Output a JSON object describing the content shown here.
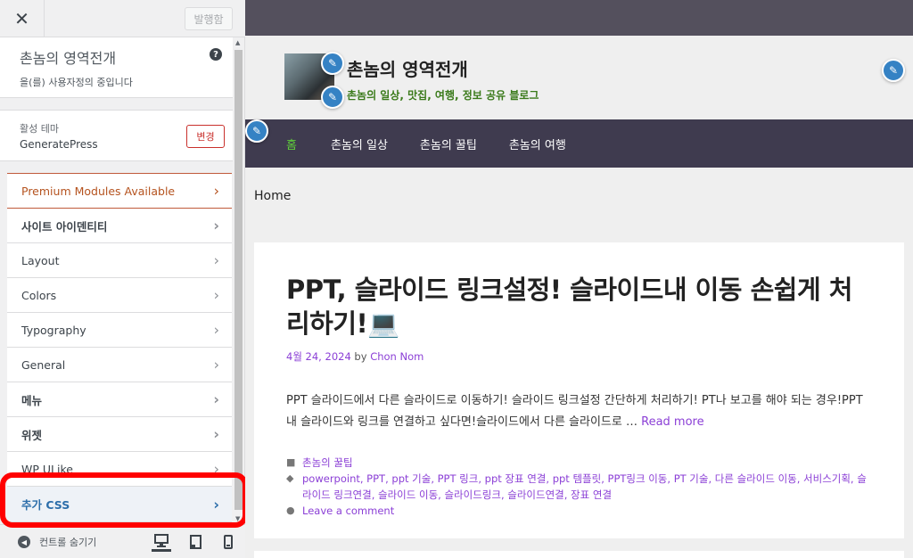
{
  "customizer": {
    "close_symbol": "✕",
    "publish_label": "발행함",
    "site_title": "촌놈의 영역전개",
    "customizing_status": "을(를) 사용자정의 중입니다",
    "help_symbol": "?",
    "active_theme_label": "활성 테마",
    "active_theme_name": "GeneratePress",
    "change_label": "변경",
    "menu_items": [
      {
        "label": "Premium Modules Available"
      },
      {
        "label": "사이트 아이덴티티"
      },
      {
        "label": "Layout"
      },
      {
        "label": "Colors"
      },
      {
        "label": "Typography"
      },
      {
        "label": "General"
      },
      {
        "label": "메뉴"
      },
      {
        "label": "위젯"
      },
      {
        "label": "WP ULike"
      },
      {
        "label": "추가 CSS"
      }
    ],
    "hide_controls_label": "컨트롤 숨기기",
    "devices": [
      "desktop-icon",
      "tablet-icon",
      "mobile-icon"
    ],
    "highlight_color": "#ff0000"
  },
  "preview": {
    "site_title": "촌놈의 영역전개",
    "tagline": "촌놈의 일상, 맛집, 여행, 정보 공유 블로그",
    "nav": [
      "홈",
      "촌놈의 일상",
      "촌놈의 꿀팁",
      "촌놈의 여행"
    ],
    "breadcrumb": "Home",
    "post": {
      "title": "PPT, 슬라이드 링크설정! 슬라이드내 이동 손쉽게 처리하기!💻",
      "date": "4월 24, 2024",
      "by": " by ",
      "author": "Chon Nom",
      "excerpt": "PPT 슬라이드에서 다른 슬라이드로 이동하기! 슬라이드 링크설정 간단하게 처리하기! PT나 보고를 해야 되는 경우!PPT 내 슬라이드와 링크를 연결하고 싶다면!슬라이드에서 다른 슬라이드로 … ",
      "read_more": "Read more",
      "category": "촌놈의 꿀팁",
      "tags": "powerpoint, PPT, ppt 기술, PPT 링크, ppt 장표 연결, ppt 템플릿, PPT링크 이동, PT 기술, 다른 슬라이드 이동, 서비스기획, 슬라이드 링크연결, 슬라이드 이동, 슬라이드링크, 슬라이드연결, 장표 연결",
      "comment": "Leave a comment"
    },
    "colors": {
      "nav_bg": "#3f3b4f",
      "nav_current": "#5fcf3a",
      "link": "#8b3fd6",
      "tagline": "#3a7a1a"
    }
  }
}
